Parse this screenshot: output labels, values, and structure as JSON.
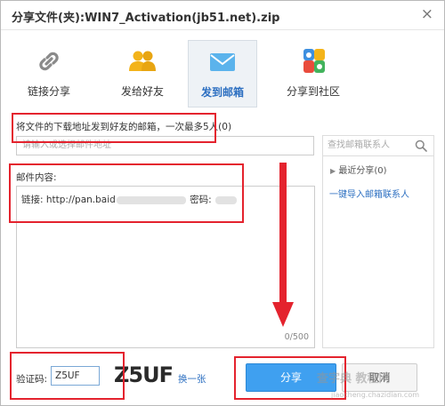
{
  "window": {
    "title": "分享文件(夹):WIN7_Activation(jb51.net).zip",
    "close_label": "×"
  },
  "tabs": [
    {
      "label": "链接分享",
      "icon": "link-icon"
    },
    {
      "label": "发给好友",
      "icon": "friends-icon"
    },
    {
      "label": "发到邮箱",
      "icon": "mail-icon"
    },
    {
      "label": "分享到社区",
      "icon": "community-icon"
    }
  ],
  "active_tab": "发到邮箱",
  "email": {
    "hint": "将文件的下载地址发到好友的邮箱，一次最多5人(0)",
    "address_placeholder": "请输入或选择邮件地址",
    "content_label": "邮件内容:",
    "content_prefix": "链接: http://pan.baid",
    "content_password_label": "密码:",
    "counter": "0/500"
  },
  "sidebar": {
    "search_placeholder": "查找邮箱联系人",
    "recent": "最近分享(0)",
    "import_link": "一键导入邮箱联系人"
  },
  "verify": {
    "label": "验证码:",
    "value": "Z5UF",
    "captcha_text": "Z5UF",
    "change_link": "换一张"
  },
  "buttons": {
    "share": "分享",
    "cancel": "取消"
  },
  "watermark": {
    "main": "查字典 教程网",
    "sub": "jiaocheng.chazidian.com"
  },
  "colors": {
    "accent": "#3fa0f0",
    "highlight_box": "#e4232e",
    "link": "#2c6fc1"
  }
}
